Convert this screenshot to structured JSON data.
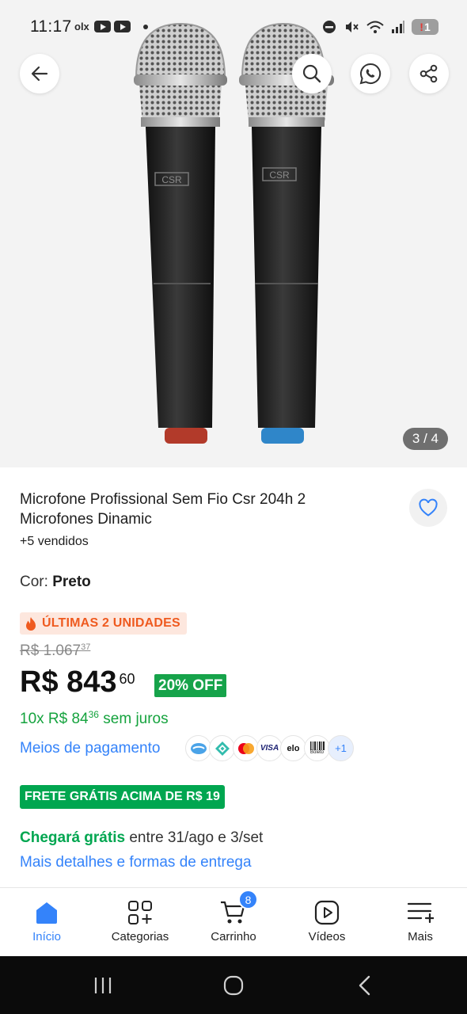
{
  "status_bar": {
    "time": "11:17",
    "app_text": "olx",
    "battery_level": "1"
  },
  "gallery": {
    "counter": "3 / 4",
    "current_image": 3,
    "total_images": 4,
    "brand_engraving": "CSR",
    "icons": [
      "back-arrow-icon",
      "search-icon",
      "whatsapp-icon",
      "share-icon"
    ]
  },
  "product": {
    "title": "Microfone Profissional Sem Fio Csr 204h 2 Microfones Dinamic",
    "sold": "+5 vendidos",
    "color_label": "Cor:",
    "color_value": "Preto",
    "stock_alert": "ÚLTIMAS 2 UNIDADES",
    "old_price_main": "R$ 1.067",
    "old_price_cents": "37",
    "price_main": "R$ 843",
    "price_cents": "60",
    "discount": "20% OFF",
    "installments_prefix": "10x R$ 84",
    "installments_cents": "36",
    "installments_suffix": "sem juros",
    "payment_link": "Meios de pagamento",
    "payment_more": "+1",
    "payment_visa": "VISA",
    "payment_elo": "elo",
    "payment_boleto": "Boleto",
    "free_shipping": "FRETE GRÁTIS ACIMA DE R$ 19",
    "arrival_highlight": "Chegará grátis",
    "arrival_rest": " entre 31/ago e 3/set",
    "details_link": "Mais detalhes e formas de entrega"
  },
  "bottom_nav": {
    "items": [
      {
        "label": "Início",
        "icon": "home-icon"
      },
      {
        "label": "Categorias",
        "icon": "categories-icon"
      },
      {
        "label": "Carrinho",
        "icon": "cart-icon"
      },
      {
        "label": "Vídeos",
        "icon": "video-icon"
      },
      {
        "label": "Mais",
        "icon": "more-icon"
      }
    ],
    "active": "Início",
    "cart_count": "8"
  },
  "colors": {
    "accent_blue": "#3483fa",
    "green": "#00a650",
    "discount_green": "#16a34a",
    "alert_orange": "#ef5a1f"
  }
}
